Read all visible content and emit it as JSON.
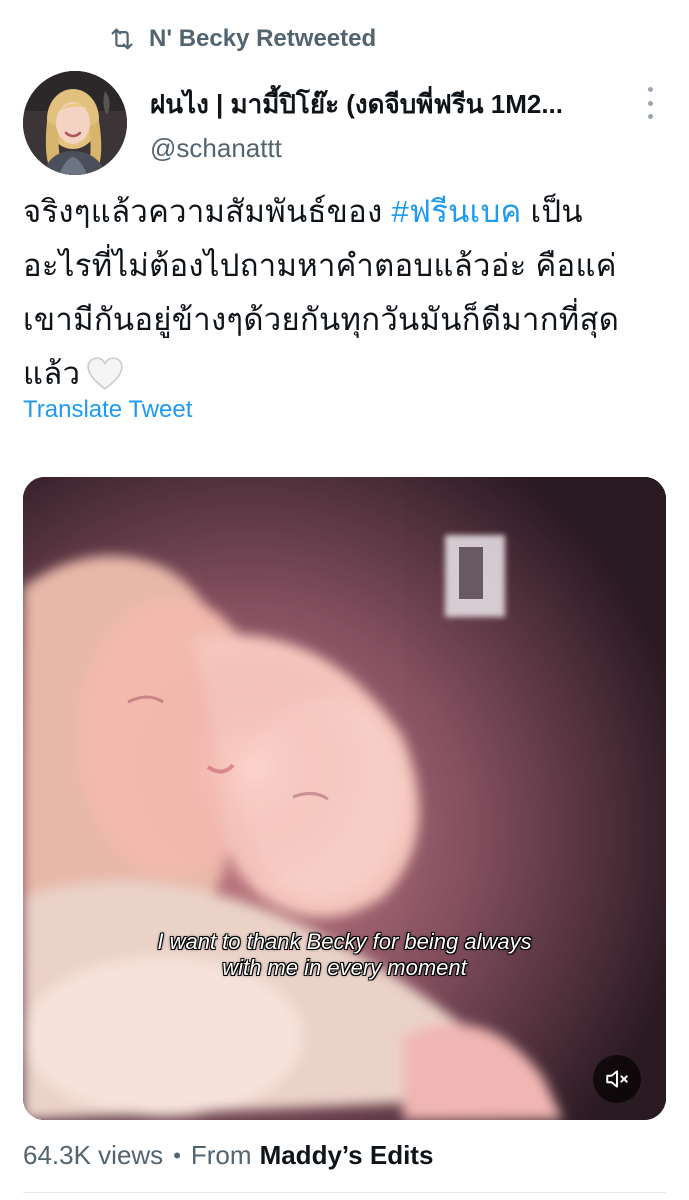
{
  "retweet": {
    "label": "N' Becky Retweeted",
    "icon": "retweet-icon"
  },
  "author": {
    "display_name": "ฝนไง | มามี้ปิโย๊ะ (งดจีบพี่ฟรีน 1M2...",
    "handle": "@schanattt"
  },
  "tweet": {
    "line1_before": "จริงๆแล้วความสัมพันธ์ของ ",
    "hashtag": "#ฟรีนเบค",
    "line1_after": " เป็น",
    "line2": "อะไรที่ไม่ต้องไปถามหาคำตอบแล้วอ่ะ คือแค่",
    "line3": "เขามีกันอยู่ข้างๆด้วยกันทุกวันมันก็ดีมากที่สุด",
    "line4": "แล้ว",
    "emoji": "white-heart-emoji"
  },
  "translate_label": "Translate Tweet",
  "media": {
    "caption_line1": "I want to thank Becky for being  always",
    "caption_line2": "with me in every moment",
    "mute_icon": "speaker-muted-icon"
  },
  "footer": {
    "views": "64.3K views",
    "separator": "•",
    "from_label": "From",
    "source_name": "Maddy’s Edits"
  },
  "colors": {
    "link": "#1d9bf0",
    "muted_text": "#536471",
    "primary_text": "#0f1419"
  }
}
